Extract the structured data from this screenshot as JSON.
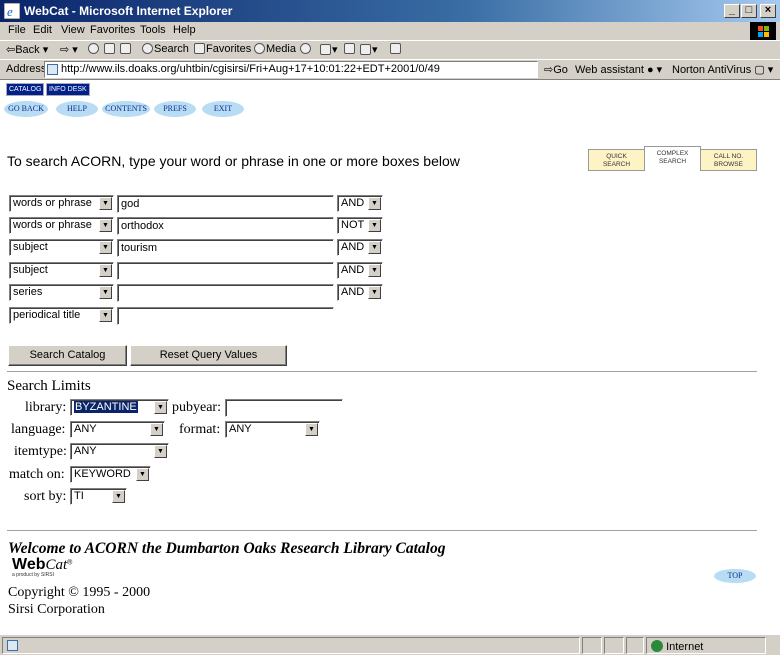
{
  "window": {
    "title": "WebCat - Microsoft Internet Explorer"
  },
  "menu": [
    "File",
    "Edit",
    "View",
    "Favorites",
    "Tools",
    "Help"
  ],
  "toolbar": {
    "back": "Back",
    "search": "Search",
    "favorites": "Favorites",
    "media": "Media"
  },
  "address": {
    "label": "Address",
    "url": "http://www.ils.doaks.org/uhtbin/cgisirsi/Fri+Aug+17+10:01:22+EDT+2001/0/49",
    "go": "Go",
    "web_assistant": "Web assistant",
    "norton": "Norton AntiVirus"
  },
  "top_tabs": [
    "CATALOG",
    "INFO DESK"
  ],
  "nav": [
    "GO BACK",
    "HELP",
    "CONTENTS",
    "PREFS",
    "EXIT"
  ],
  "intro": "To search ACORN, type your word or phrase in one or more boxes below",
  "search_modes": [
    {
      "line1": "QUICK",
      "line2": "SEARCH"
    },
    {
      "line1": "COMPLEX",
      "line2": "SEARCH"
    },
    {
      "line1": "CALL NO.",
      "line2": "BROWSE"
    }
  ],
  "rows": [
    {
      "field": "words or phrase",
      "value": "god",
      "op": "AND"
    },
    {
      "field": "words or phrase",
      "value": "orthodox",
      "op": "NOT"
    },
    {
      "field": "subject",
      "value": "tourism",
      "op": "AND"
    },
    {
      "field": "subject",
      "value": "",
      "op": "AND"
    },
    {
      "field": "series",
      "value": "",
      "op": "AND"
    },
    {
      "field": "periodical title",
      "value": ""
    }
  ],
  "buttons": {
    "search": "Search Catalog",
    "reset": "Reset Query Values"
  },
  "limits": {
    "heading": "Search Limits",
    "library_label": "library:",
    "library_value": "BYZANTINE",
    "pubyear_label": "pubyear:",
    "pubyear_value": "",
    "language_label": "language:",
    "language_value": "ANY",
    "format_label": "format:",
    "format_value": "ANY",
    "itemtype_label": "itemtype:",
    "itemtype_value": "ANY",
    "match_label": "match on:",
    "match_value": "KEYWORD",
    "sort_label": "sort by:",
    "sort_value": "TI"
  },
  "footer": {
    "welcome": "Welcome to ACORN the Dumbarton Oaks Research Library Catalog",
    "logo_web": "Web",
    "logo_cat": "Cat",
    "logo_sub": "a product by SIRSI",
    "copyright": "Copyright © 1995 - 2000",
    "company": "Sirsi Corporation",
    "top": "TOP"
  },
  "status": {
    "zone": "Internet"
  }
}
